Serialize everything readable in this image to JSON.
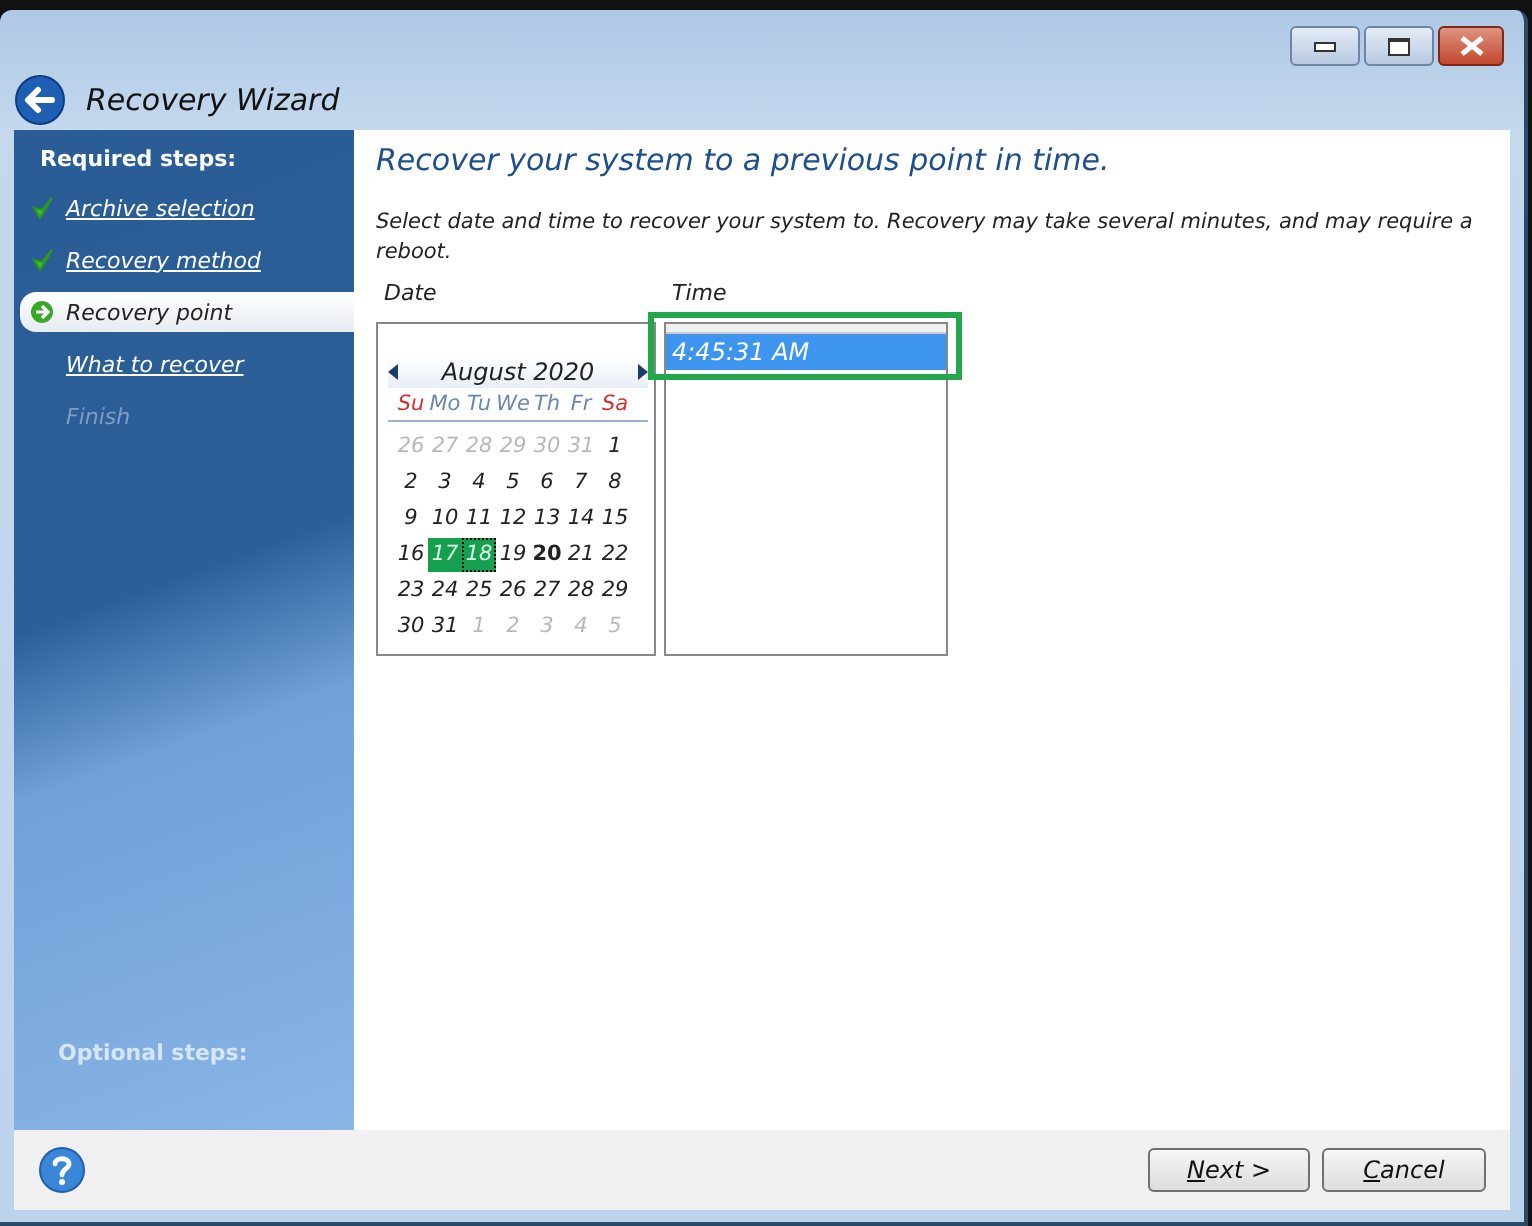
{
  "window": {
    "title": "Recovery Wizard"
  },
  "sidebar": {
    "heading": "Required steps:",
    "items": [
      {
        "label": "Archive selection",
        "kind": "done",
        "selected": false
      },
      {
        "label": "Recovery method",
        "kind": "done",
        "selected": false
      },
      {
        "label": "Recovery point",
        "kind": "current",
        "selected": true
      },
      {
        "label": "What to recover",
        "kind": "pending",
        "selected": false
      },
      {
        "label": "Finish",
        "kind": "disabled",
        "selected": false
      }
    ],
    "footer_heading": "Optional steps:"
  },
  "content": {
    "title": "Recover your system to a previous point in time.",
    "description": "Select date and time to recover your system to. Recovery may take several minutes, and may require a reboot.",
    "date_label": "Date",
    "time_label": "Time",
    "calendar": {
      "month": "August 2020",
      "weekdays": [
        {
          "label": "Su",
          "weekend": true
        },
        {
          "label": "Mo",
          "weekend": false
        },
        {
          "label": "Tu",
          "weekend": false
        },
        {
          "label": "We",
          "weekend": false
        },
        {
          "label": "Th",
          "weekend": false
        },
        {
          "label": "Fr",
          "weekend": false
        },
        {
          "label": "Sa",
          "weekend": true
        }
      ],
      "days": [
        {
          "day": "26",
          "kind": "other",
          "selected": false,
          "focused": false,
          "today": false
        },
        {
          "day": "27",
          "kind": "other",
          "selected": false,
          "focused": false,
          "today": false
        },
        {
          "day": "28",
          "kind": "other",
          "selected": false,
          "focused": false,
          "today": false
        },
        {
          "day": "29",
          "kind": "other",
          "selected": false,
          "focused": false,
          "today": false
        },
        {
          "day": "30",
          "kind": "other",
          "selected": false,
          "focused": false,
          "today": false
        },
        {
          "day": "31",
          "kind": "other",
          "selected": false,
          "focused": false,
          "today": false
        },
        {
          "day": "1",
          "kind": "month",
          "selected": false,
          "focused": false,
          "today": false
        },
        {
          "day": "2",
          "kind": "month",
          "selected": false,
          "focused": false,
          "today": false
        },
        {
          "day": "3",
          "kind": "month",
          "selected": false,
          "focused": false,
          "today": false
        },
        {
          "day": "4",
          "kind": "month",
          "selected": false,
          "focused": false,
          "today": false
        },
        {
          "day": "5",
          "kind": "month",
          "selected": false,
          "focused": false,
          "today": false
        },
        {
          "day": "6",
          "kind": "month",
          "selected": false,
          "focused": false,
          "today": false
        },
        {
          "day": "7",
          "kind": "month",
          "selected": false,
          "focused": false,
          "today": false
        },
        {
          "day": "8",
          "kind": "month",
          "selected": false,
          "focused": false,
          "today": false
        },
        {
          "day": "9",
          "kind": "month",
          "selected": false,
          "focused": false,
          "today": false
        },
        {
          "day": "10",
          "kind": "month",
          "selected": false,
          "focused": false,
          "today": false
        },
        {
          "day": "11",
          "kind": "month",
          "selected": false,
          "focused": false,
          "today": false
        },
        {
          "day": "12",
          "kind": "month",
          "selected": false,
          "focused": false,
          "today": false
        },
        {
          "day": "13",
          "kind": "month",
          "selected": false,
          "focused": false,
          "today": false
        },
        {
          "day": "14",
          "kind": "month",
          "selected": false,
          "focused": false,
          "today": false
        },
        {
          "day": "15",
          "kind": "month",
          "selected": false,
          "focused": false,
          "today": false
        },
        {
          "day": "16",
          "kind": "month",
          "selected": false,
          "focused": false,
          "today": false
        },
        {
          "day": "17",
          "kind": "month",
          "selected": true,
          "focused": false,
          "today": false
        },
        {
          "day": "18",
          "kind": "month",
          "selected": true,
          "focused": true,
          "today": false
        },
        {
          "day": "19",
          "kind": "month",
          "selected": false,
          "focused": false,
          "today": false
        },
        {
          "day": "20",
          "kind": "month",
          "selected": false,
          "focused": false,
          "today": true
        },
        {
          "day": "21",
          "kind": "month",
          "selected": false,
          "focused": false,
          "today": false
        },
        {
          "day": "22",
          "kind": "month",
          "selected": false,
          "focused": false,
          "today": false
        },
        {
          "day": "23",
          "kind": "month",
          "selected": false,
          "focused": false,
          "today": false
        },
        {
          "day": "24",
          "kind": "month",
          "selected": false,
          "focused": false,
          "today": false
        },
        {
          "day": "25",
          "kind": "month",
          "selected": false,
          "focused": false,
          "today": false
        },
        {
          "day": "26",
          "kind": "month",
          "selected": false,
          "focused": false,
          "today": false
        },
        {
          "day": "27",
          "kind": "month",
          "selected": false,
          "focused": false,
          "today": false
        },
        {
          "day": "28",
          "kind": "month",
          "selected": false,
          "focused": false,
          "today": false
        },
        {
          "day": "29",
          "kind": "month",
          "selected": false,
          "focused": false,
          "today": false
        },
        {
          "day": "30",
          "kind": "month",
          "selected": false,
          "focused": false,
          "today": false
        },
        {
          "day": "31",
          "kind": "month",
          "selected": false,
          "focused": false,
          "today": false
        },
        {
          "day": "1",
          "kind": "other",
          "selected": false,
          "focused": false,
          "today": false
        },
        {
          "day": "2",
          "kind": "other",
          "selected": false,
          "focused": false,
          "today": false
        },
        {
          "day": "3",
          "kind": "other",
          "selected": false,
          "focused": false,
          "today": false
        },
        {
          "day": "4",
          "kind": "other",
          "selected": false,
          "focused": false,
          "today": false
        },
        {
          "day": "5",
          "kind": "other",
          "selected": false,
          "focused": false,
          "today": false
        }
      ]
    },
    "times": [
      {
        "label": "4:45:31 AM",
        "selected": true,
        "highlighted": true
      }
    ]
  },
  "buttons": [
    {
      "label": "Next >",
      "kind": "next"
    },
    {
      "label": "Cancel",
      "kind": "cancel"
    }
  ]
}
